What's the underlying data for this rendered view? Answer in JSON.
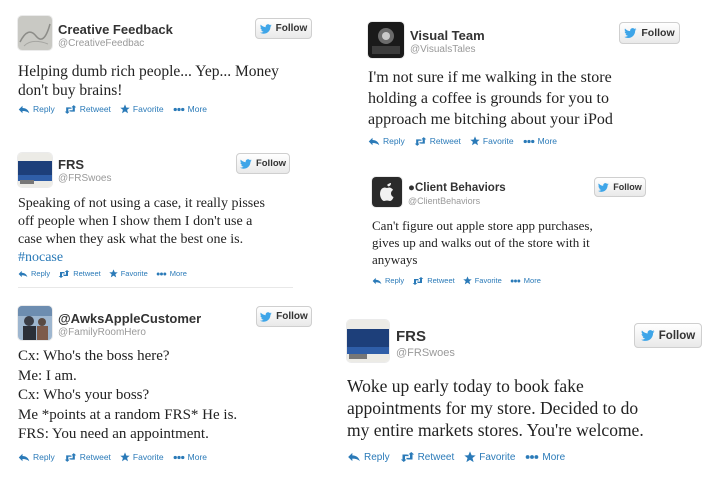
{
  "colors": {
    "link": "#2a7ab8",
    "name": "#333333",
    "handle": "#999999",
    "text": "#222222"
  },
  "icons": {
    "reply": "reply-arrow-icon",
    "retweet": "retweet-icon",
    "favorite": "star-icon",
    "more": "more-dots-icon",
    "follow": "twitter-bird-icon"
  },
  "tweets": [
    {
      "name": "Creative Feedback",
      "handle": "@CreativeFeedbac",
      "follow": "Follow",
      "lines": [
        "Helping dumb rich people... Yep... Money",
        "don't buy brains!"
      ],
      "actions": {
        "reply": "Reply",
        "retweet": "Retweet",
        "favorite": "Favorite",
        "more": "More"
      }
    },
    {
      "name": "FRS",
      "handle": "@FRSwoes",
      "follow": "Follow",
      "lines": [
        "Speaking of not using a case, it really pisses",
        "off people when I show them I don't use a",
        "case when they ask what the best one is."
      ],
      "hashtag": "#nocase",
      "actions": {
        "reply": "Reply",
        "retweet": "Retweet",
        "favorite": "Favorite",
        "more": "More"
      }
    },
    {
      "name": "@AwksAppleCustomer",
      "handle": "@FamilyRoomHero",
      "follow": "Follow",
      "lines": [
        "Cx: Who's the boss here?",
        "Me: I am.",
        "Cx: Who's your boss?",
        "Me *points at a random FRS* He is.",
        "FRS: You need an appointment."
      ],
      "actions": {
        "reply": "Reply",
        "retweet": "Retweet",
        "favorite": "Favorite",
        "more": "More"
      }
    },
    {
      "name": "Visual Team",
      "handle": "@VisualsTales",
      "follow": "Follow",
      "lines": [
        "I'm not sure if me walking in the store",
        "holding a coffee is grounds for you to",
        "approach me bitching about your iPod"
      ],
      "actions": {
        "reply": "Reply",
        "retweet": "Retweet",
        "favorite": "Favorite",
        "more": "More"
      }
    },
    {
      "name": "Client Behaviors",
      "handle": "@ClientBehaviors",
      "follow": "Follow",
      "lines": [
        "Can't figure out apple store app purchases,",
        "gives up and walks out of the store with it",
        "anyways"
      ],
      "actions": {
        "reply": "Reply",
        "retweet": "Retweet",
        "favorite": "Favorite",
        "more": "More"
      }
    },
    {
      "name": "FRS",
      "handle": "@FRSwoes",
      "follow": "Follow",
      "lines": [
        "Woke up early today to book fake",
        "appointments for my store. Decided to do",
        "my entire markets stores. You're welcome."
      ],
      "actions": {
        "reply": "Reply",
        "retweet": "Retweet",
        "favorite": "Favorite",
        "more": "More"
      }
    }
  ]
}
